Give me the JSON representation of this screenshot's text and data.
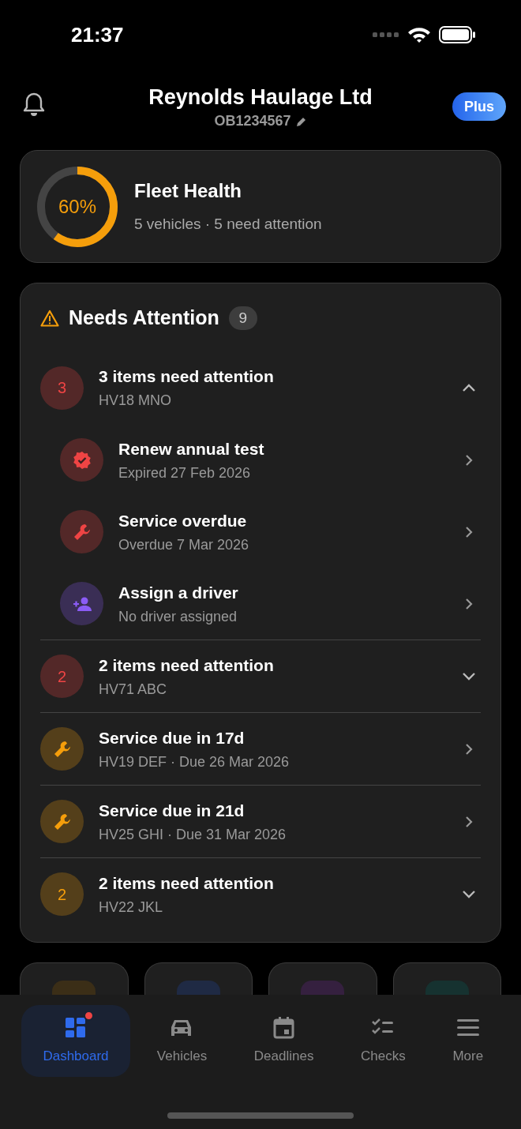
{
  "status_bar": {
    "time": "21:37"
  },
  "header": {
    "title": "Reynolds Haulage Ltd",
    "subtitle": "OB1234567",
    "plan_badge": "Plus"
  },
  "fleet_health": {
    "percent": "60%",
    "level": 0.6,
    "title": "Fleet Health",
    "summary": "5 vehicles · 5 need attention"
  },
  "needs_attention": {
    "title": "Needs Attention",
    "count": "9",
    "items": [
      {
        "kind": "group",
        "color": "#ef4444",
        "count": "3",
        "title": "3 items need attention",
        "subtitle": "HV18 MNO",
        "expanded": true,
        "children": [
          {
            "kind": "test",
            "color": "#ef4444",
            "title": "Renew annual test",
            "subtitle": "Expired 27 Feb 2026"
          },
          {
            "kind": "service",
            "color": "#ef4444",
            "title": "Service overdue",
            "subtitle": "Overdue 7 Mar 2026"
          },
          {
            "kind": "driver",
            "color": "#8b5cf6",
            "title": "Assign a driver",
            "subtitle": "No driver assigned"
          }
        ]
      },
      {
        "kind": "group",
        "color": "#ef4444",
        "count": "2",
        "title": "2 items need attention",
        "subtitle": "HV71 ABC",
        "expanded": false
      },
      {
        "kind": "service",
        "color": "#f59e0b",
        "title": "Service due in 17d",
        "subtitle": "HV19 DEF · Due 26 Mar 2026"
      },
      {
        "kind": "service",
        "color": "#f59e0b",
        "title": "Service due in 21d",
        "subtitle": "HV25 GHI · Due 31 Mar 2026"
      },
      {
        "kind": "group",
        "color": "#f59e0b",
        "count": "2",
        "title": "2 items need attention",
        "subtitle": "HV22 JKL",
        "expanded": false
      }
    ]
  },
  "quick_tiles": [
    {
      "color": "#3b2e17"
    },
    {
      "color": "#1f2a44"
    },
    {
      "color": "#35203f"
    },
    {
      "color": "#163230"
    }
  ],
  "tab_bar": [
    {
      "kind": "dashboard",
      "label": "Dashboard",
      "selected": true,
      "alert": true
    },
    {
      "kind": "vehicles",
      "label": "Vehicles",
      "selected": false,
      "alert": false
    },
    {
      "kind": "deadlines",
      "label": "Deadlines",
      "selected": false,
      "alert": false
    },
    {
      "kind": "checks",
      "label": "Checks",
      "selected": false,
      "alert": false
    },
    {
      "kind": "more",
      "label": "More",
      "selected": false,
      "alert": false
    }
  ]
}
